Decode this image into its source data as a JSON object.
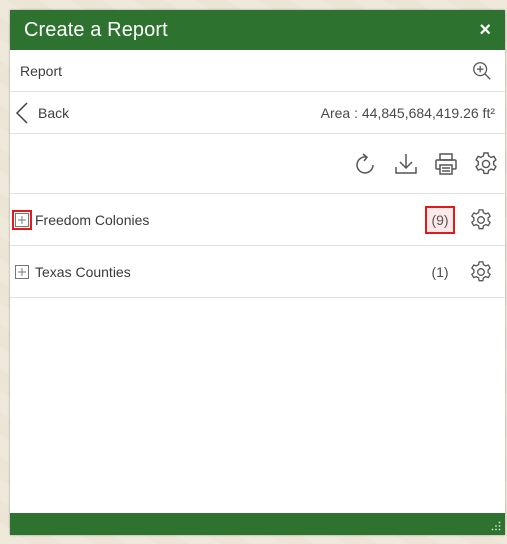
{
  "window": {
    "title": "Create a Report",
    "close_glyph": "×"
  },
  "report_row": {
    "label": "Report",
    "icon": "zoom-in-icon"
  },
  "nav": {
    "back_label": "Back",
    "area_text": "Area : 44,845,684,419.26 ft²"
  },
  "toolbar": {
    "icons": [
      "refresh-icon",
      "download-icon",
      "print-icon",
      "settings-icon"
    ]
  },
  "layers": [
    {
      "name": "Freedom Colonies",
      "count": "(9)",
      "highlighted": true
    },
    {
      "name": "Texas Counties",
      "count": "(1)",
      "highlighted": false
    }
  ],
  "colors": {
    "header": "#2e7230",
    "highlight": "#e11b1b"
  }
}
